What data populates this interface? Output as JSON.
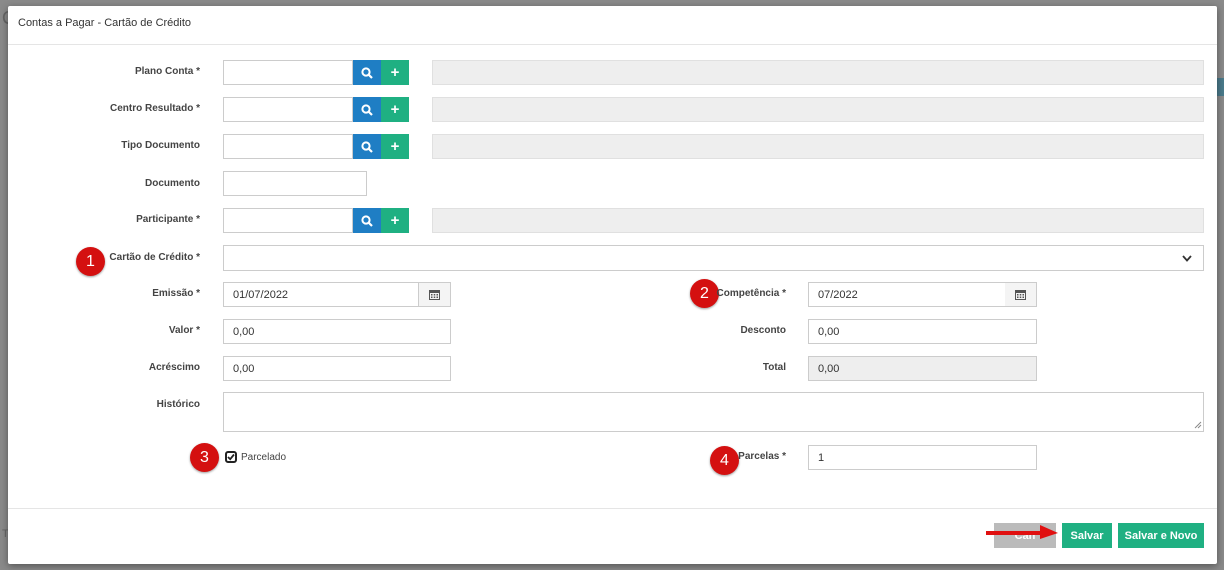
{
  "background": {
    "hint_top": "C",
    "hint_side": "T"
  },
  "modal": {
    "title": "Contas a Pagar - Cartão de Crédito"
  },
  "form": {
    "plano_conta": {
      "label": "Plano Conta *",
      "value": ""
    },
    "centro_resultado": {
      "label": "Centro Resultado *",
      "value": ""
    },
    "tipo_documento": {
      "label": "Tipo Documento",
      "value": ""
    },
    "documento": {
      "label": "Documento",
      "value": ""
    },
    "participante": {
      "label": "Participante *",
      "value": ""
    },
    "cartao_credito": {
      "label": "Cartão de Crédito *",
      "value": ""
    },
    "emissao": {
      "label": "Emissão *",
      "value": "01/07/2022"
    },
    "competencia": {
      "label": "Competência *",
      "value": "07/2022"
    },
    "valor": {
      "label": "Valor *",
      "value": "0,00"
    },
    "desconto": {
      "label": "Desconto",
      "value": "0,00"
    },
    "acrescimo": {
      "label": "Acréscimo",
      "value": "0,00"
    },
    "total": {
      "label": "Total",
      "value": "0,00"
    },
    "historico": {
      "label": "Histórico",
      "value": ""
    },
    "parcelado": {
      "label": "Parcelado",
      "checked": true
    },
    "parcelas": {
      "label": "Parcelas *",
      "value": "1"
    }
  },
  "annotations": {
    "b1": "1",
    "b2": "2",
    "b3": "3",
    "b4": "4"
  },
  "footer": {
    "cancel_label": "Can",
    "save_label": "Salvar",
    "save_new_label": "Salvar e Novo"
  },
  "colors": {
    "search": "#1f7ec4",
    "add": "#1fb082",
    "badge": "#d41010",
    "arrow": "#e01010"
  },
  "icons": {
    "search": "search-icon",
    "add": "plus-icon",
    "calendar": "calendar-icon",
    "dropdown": "chevron-down-icon"
  }
}
